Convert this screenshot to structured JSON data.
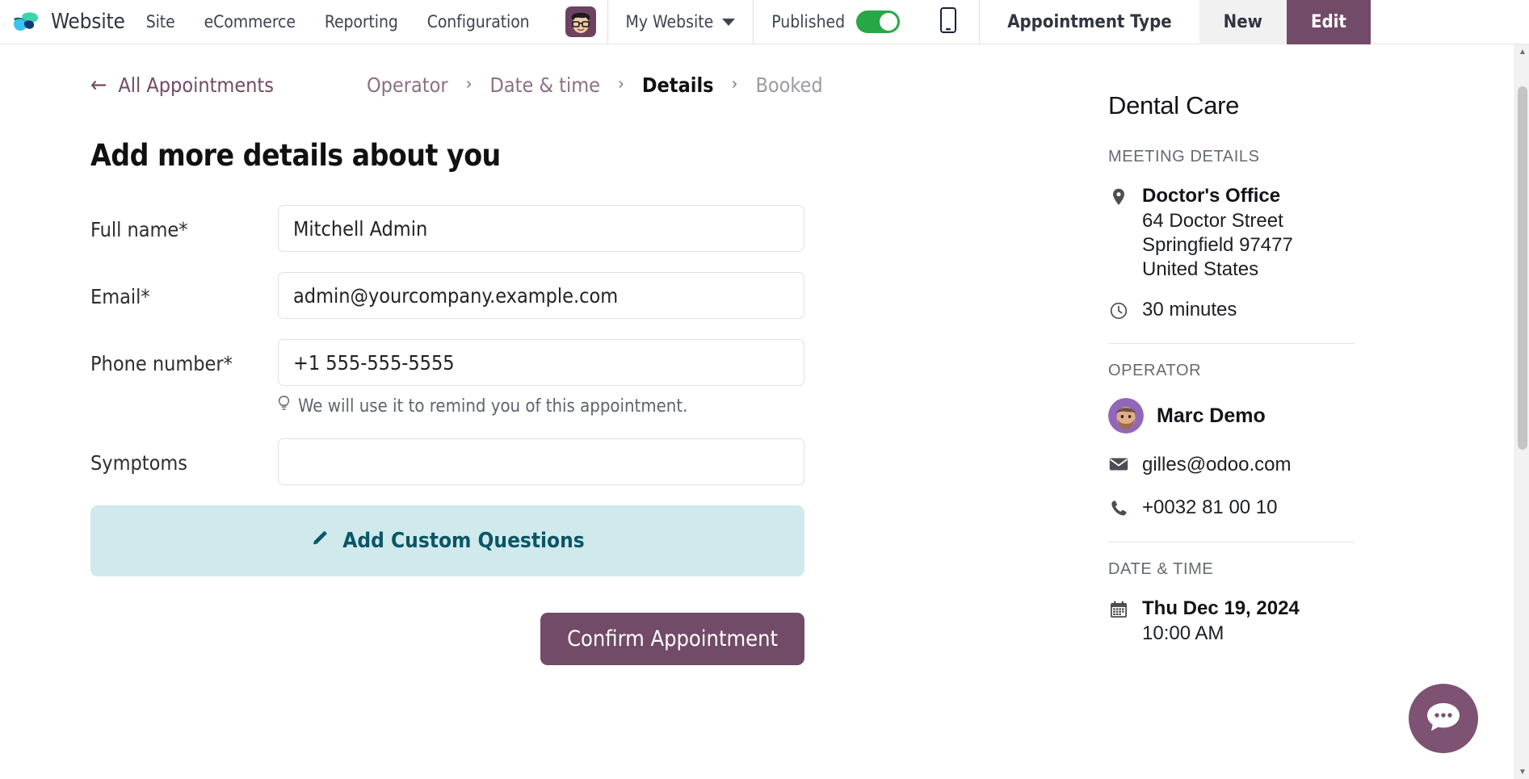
{
  "navbar": {
    "brand": "Website",
    "logo_icon": "odoo-logo-icon",
    "menu": [
      "Site",
      "eCommerce",
      "Reporting",
      "Configuration"
    ],
    "avatar_icon": "user-avatar-icon",
    "site_selector": "My Website",
    "site_caret_icon": "chevron-down-icon",
    "published_label": "Published",
    "published_on": true,
    "mobile_preview_icon": "mobile-phone-icon",
    "record_title": "Appointment Type",
    "new_label": "New",
    "edit_label": "Edit"
  },
  "breadcrumb": {
    "back_icon": "arrow-left-icon",
    "back_label": "All Appointments",
    "separator": "›",
    "steps": [
      {
        "label": "Operator",
        "state": "done"
      },
      {
        "label": "Date & time",
        "state": "done"
      },
      {
        "label": "Details",
        "state": "active"
      },
      {
        "label": "Booked",
        "state": "upcoming"
      }
    ]
  },
  "form": {
    "headline": "Add more details about you",
    "fields": [
      {
        "label": "Full name*",
        "value": "Mitchell Admin",
        "name": "full-name-input",
        "placeholder": ""
      },
      {
        "label": "Email*",
        "value": "admin@yourcompany.example.com",
        "name": "email-input",
        "placeholder": ""
      },
      {
        "label": "Phone number*",
        "value": "+1 555-555-5555",
        "name": "phone-input",
        "placeholder": ""
      },
      {
        "label": "Symptoms",
        "value": "",
        "name": "symptoms-input",
        "placeholder": ""
      }
    ],
    "phone_hint": "We will use it to remind you of this appointment.",
    "phone_hint_icon": "lightbulb-icon",
    "add_questions_label": "Add Custom Questions",
    "add_questions_icon": "pencil-icon",
    "add_questions_bg": "#cfe9ec",
    "confirm_label": "Confirm Appointment",
    "confirm_bg": "#714b67"
  },
  "sidebar": {
    "title": "Dental Care",
    "meeting_details": {
      "heading": "MEETING DETAILS",
      "location_icon": "map-pin-icon",
      "location_name": "Doctor's Office",
      "address_lines": [
        "64 Doctor Street",
        "Springfield 97477",
        "United States"
      ],
      "duration_icon": "clock-icon",
      "duration": "30 minutes"
    },
    "operator": {
      "heading": "OPERATOR",
      "avatar_icon": "operator-avatar-icon",
      "name": "Marc Demo",
      "email_icon": "envelope-icon",
      "email": "gilles@odoo.com",
      "phone_icon": "phone-icon",
      "phone": "+0032 81 00 10"
    },
    "datetime": {
      "heading": "DATE & TIME",
      "calendar_icon": "calendar-icon",
      "date": "Thu Dec 19, 2024",
      "time": "10:00 AM"
    }
  },
  "chat": {
    "icon": "chat-bubble-icon"
  },
  "scrollbar": {
    "up_icon": "scroll-up-icon",
    "down_icon": "scroll-down-icon"
  }
}
